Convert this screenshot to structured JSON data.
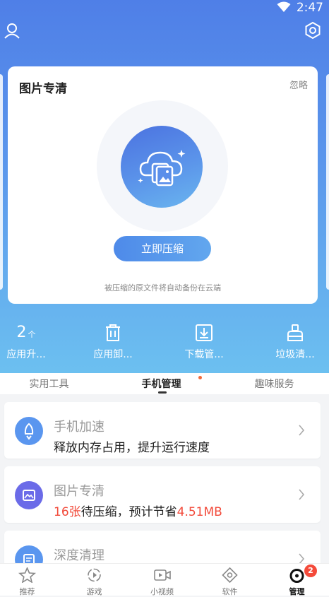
{
  "status_bar": {
    "time": "2:47"
  },
  "promo": {
    "title": "图片专清",
    "ignore_label": "忽略",
    "button_label": "立即压缩",
    "note": "被压缩的原文件将自动备份在云端"
  },
  "quick_actions": [
    {
      "icon": "update-count",
      "number": "2",
      "unit": "个",
      "label": "应用升..."
    },
    {
      "icon": "trash-icon",
      "label": "应用卸..."
    },
    {
      "icon": "download-icon",
      "label": "下载管..."
    },
    {
      "icon": "broom-icon",
      "label": "垃圾清..."
    }
  ],
  "tabs": [
    {
      "label": "实用工具"
    },
    {
      "label": "手机管理",
      "active": true
    },
    {
      "label": "趣味服务"
    }
  ],
  "list": [
    {
      "icon": "rocket-icon",
      "color": "#5a96ef",
      "title": "手机加速",
      "desc": "释放内存占用，提升运行速度"
    },
    {
      "icon": "image-icon",
      "color": "#6b6be8",
      "title": "图片专清",
      "count": "16张",
      "desc_mid": "待压缩，预计节省",
      "size": "4.51MB"
    },
    {
      "icon": "clean-icon",
      "color": "#5a96ef",
      "title": "深度清理"
    }
  ],
  "bottom_nav": [
    {
      "icon": "star-icon",
      "label": "推荐"
    },
    {
      "icon": "game-icon",
      "label": "游戏"
    },
    {
      "icon": "video-icon",
      "label": "小视频"
    },
    {
      "icon": "software-icon",
      "label": "软件"
    },
    {
      "icon": "manage-icon",
      "label": "管理",
      "active": true,
      "badge": "2"
    }
  ]
}
